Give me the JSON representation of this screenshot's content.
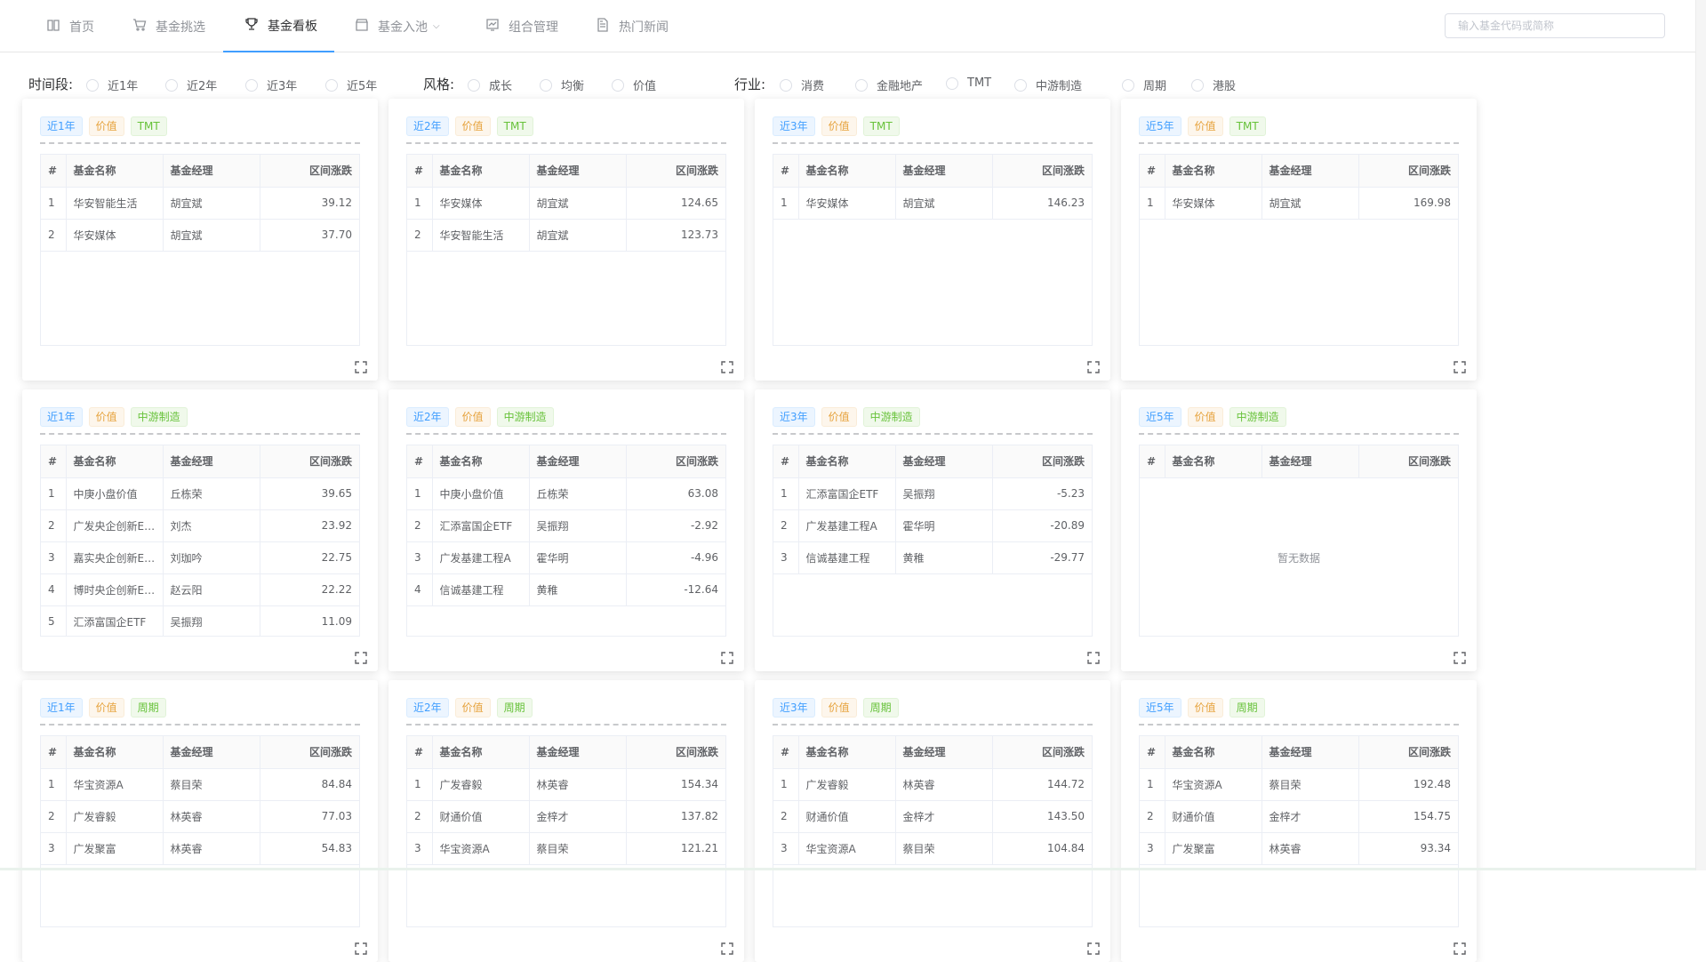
{
  "nav": {
    "items": [
      {
        "label": "首页",
        "icon": "book-icon",
        "active": false
      },
      {
        "label": "基金挑选",
        "icon": "cart-icon",
        "active": false
      },
      {
        "label": "基金看板",
        "icon": "trophy-icon",
        "active": true
      },
      {
        "label": "基金入池",
        "icon": "box-icon",
        "active": false,
        "dropdown": true
      },
      {
        "label": "组合管理",
        "icon": "chart-board-icon",
        "active": false
      },
      {
        "label": "热门新闻",
        "icon": "document-icon",
        "active": false
      }
    ],
    "search_placeholder": "输入基金代码或简称",
    "active_color": "#409eff"
  },
  "filters": {
    "period": {
      "label": "时间段:",
      "options": [
        "近1年",
        "近2年",
        "近3年",
        "近5年"
      ]
    },
    "style": {
      "label": "风格:",
      "options": [
        "成长",
        "均衡",
        "价值"
      ]
    },
    "industry": {
      "label": "行业:",
      "options": [
        "消费",
        "金融地产",
        "TMT",
        "中游制造",
        "周期",
        "港股"
      ]
    }
  },
  "table_headers": [
    "#",
    "基金名称",
    "基金经理",
    "区间涨跌"
  ],
  "empty_text": "暂无数据",
  "cards": [
    {
      "tags": [
        "近1年",
        "价值",
        "TMT"
      ],
      "rows": [
        [
          "1",
          "华安智能生活",
          "胡宜斌",
          "39.12"
        ],
        [
          "2",
          "华安媒体",
          "胡宜斌",
          "37.70"
        ]
      ]
    },
    {
      "tags": [
        "近2年",
        "价值",
        "TMT"
      ],
      "rows": [
        [
          "1",
          "华安媒体",
          "胡宜斌",
          "124.65"
        ],
        [
          "2",
          "华安智能生活",
          "胡宜斌",
          "123.73"
        ]
      ]
    },
    {
      "tags": [
        "近3年",
        "价值",
        "TMT"
      ],
      "rows": [
        [
          "1",
          "华安媒体",
          "胡宜斌",
          "146.23"
        ]
      ]
    },
    {
      "tags": [
        "近5年",
        "价值",
        "TMT"
      ],
      "rows": [
        [
          "1",
          "华安媒体",
          "胡宜斌",
          "169.98"
        ]
      ]
    },
    {
      "tags": [
        "近1年",
        "价值",
        "中游制造"
      ],
      "rows": [
        [
          "1",
          "中庚小盘价值",
          "丘栋荣",
          "39.65"
        ],
        [
          "2",
          "广发央企创新ETF",
          "刘杰",
          "23.92"
        ],
        [
          "3",
          "嘉实央企创新ETF",
          "刘珈吟",
          "22.75"
        ],
        [
          "4",
          "博时央企创新ETF",
          "赵云阳",
          "22.22"
        ],
        [
          "5",
          "汇添富国企ETF",
          "吴振翔",
          "11.09"
        ]
      ]
    },
    {
      "tags": [
        "近2年",
        "价值",
        "中游制造"
      ],
      "rows": [
        [
          "1",
          "中庚小盘价值",
          "丘栋荣",
          "63.08"
        ],
        [
          "2",
          "汇添富国企ETF",
          "吴振翔",
          "-2.92"
        ],
        [
          "3",
          "广发基建工程A",
          "霍华明",
          "-4.96"
        ],
        [
          "4",
          "信诚基建工程",
          "黄稚",
          "-12.64"
        ]
      ]
    },
    {
      "tags": [
        "近3年",
        "价值",
        "中游制造"
      ],
      "rows": [
        [
          "1",
          "汇添富国企ETF",
          "吴振翔",
          "-5.23"
        ],
        [
          "2",
          "广发基建工程A",
          "霍华明",
          "-20.89"
        ],
        [
          "3",
          "信诚基建工程",
          "黄稚",
          "-29.77"
        ]
      ]
    },
    {
      "tags": [
        "近5年",
        "价值",
        "中游制造"
      ],
      "rows": []
    },
    {
      "tags": [
        "近1年",
        "价值",
        "周期"
      ],
      "rows": [
        [
          "1",
          "华宝资源A",
          "蔡目荣",
          "84.84"
        ],
        [
          "2",
          "广发睿毅",
          "林英睿",
          "77.03"
        ],
        [
          "3",
          "广发聚富",
          "林英睿",
          "54.83"
        ]
      ]
    },
    {
      "tags": [
        "近2年",
        "价值",
        "周期"
      ],
      "rows": [
        [
          "1",
          "广发睿毅",
          "林英睿",
          "154.34"
        ],
        [
          "2",
          "财通价值",
          "金梓才",
          "137.82"
        ],
        [
          "3",
          "华宝资源A",
          "蔡目荣",
          "121.21"
        ]
      ]
    },
    {
      "tags": [
        "近3年",
        "价值",
        "周期"
      ],
      "rows": [
        [
          "1",
          "广发睿毅",
          "林英睿",
          "144.72"
        ],
        [
          "2",
          "财通价值",
          "金梓才",
          "143.50"
        ],
        [
          "3",
          "华宝资源A",
          "蔡目荣",
          "104.84"
        ]
      ]
    },
    {
      "tags": [
        "近5年",
        "价值",
        "周期"
      ],
      "rows": [
        [
          "1",
          "华宝资源A",
          "蔡目荣",
          "192.48"
        ],
        [
          "2",
          "财通价值",
          "金梓才",
          "154.75"
        ],
        [
          "3",
          "广发聚富",
          "林英睿",
          "93.34"
        ]
      ]
    }
  ]
}
